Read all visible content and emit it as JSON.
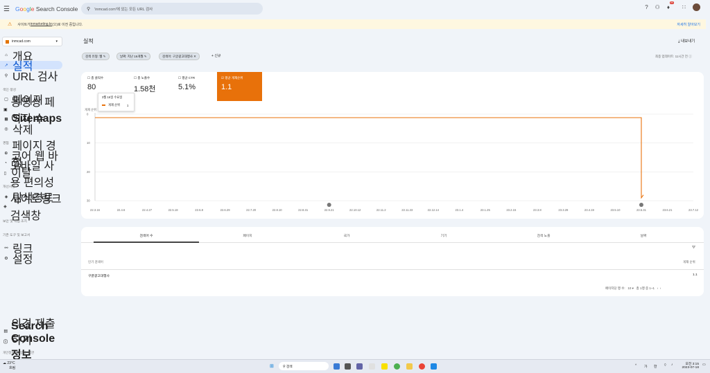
{
  "app": {
    "title": "Google Search Console"
  },
  "search": {
    "placeholder": "'inmcad.com'에 있는 모든 URL 검사"
  },
  "header_icons": [
    "help-icon",
    "people-icon",
    "bell-icon",
    "apps-icon"
  ],
  "notification_count": "99",
  "banner": {
    "prefix": "사이트가 ",
    "site": "inmarketing.kr",
    "suffix": "(으)로 이전 중입니다.",
    "more": "자세히 알아보기"
  },
  "property": "inmcad.com",
  "nav": {
    "overview": "개요",
    "performance": "실적",
    "url_inspection": "URL 검사",
    "section_index": "색인 생성",
    "pages": "페이지",
    "video_pages": "동영상 페이지 수",
    "sitemaps": "Sitemaps",
    "removals": "삭제",
    "section_experience": "경험",
    "page_experience": "페이지 경험",
    "core_web_vitals": "코어 웹 바이탈",
    "mobile_usability": "모바일 사용 편의성",
    "section_enhancements": "개선사항",
    "breadcrumbs": "탐색경로",
    "sitelinks_searchbox": "사이트링크 검색창",
    "section_security": "보안 및 직접 조치",
    "section_legacy": "기존 도구 및 보고서",
    "links": "링크",
    "settings": "설정",
    "feedback": "의견 제출하기",
    "about": "Search Console 정보",
    "privacy": "개인정보처리방침",
    "terms": "약관"
  },
  "page": {
    "title": "실적",
    "export": "내보내기",
    "updated": "최종 업데이트: 11시간 전"
  },
  "filters": [
    {
      "label": "검색 유형: 웹"
    },
    {
      "label": "날짜: 지난 16개월"
    },
    {
      "label": "검색어: 구글광고대행사"
    }
  ],
  "new_filter": "신규",
  "metrics": [
    {
      "label": "총 클릭수",
      "value": "80"
    },
    {
      "label": "총 노출수",
      "value": "1.58천"
    },
    {
      "label": "평균 CTR",
      "value": "5.1%"
    },
    {
      "label": "평균 게재순위",
      "value": "1.1"
    }
  ],
  "tooltip": {
    "date": "3월 16일 수요일",
    "series": "게재 순위",
    "value": "1"
  },
  "chart_data": {
    "type": "line",
    "ylabel": "게재 순위",
    "y_ticks": [
      "0",
      "10",
      "20",
      "30"
    ],
    "ylim": [
      0,
      30
    ],
    "y_inverted": true,
    "x_ticks": [
      "22.3.16",
      "22.4.6",
      "22.4.27",
      "22.5.18",
      "22.6.8",
      "22.6.29",
      "22.7.20",
      "22.8.10",
      "22.8.31",
      "22.9.21",
      "22.10.12",
      "22.11.2",
      "22.11.23",
      "22.12.14",
      "23.1.4",
      "23.1.25",
      "23.2.15",
      "23.3.8",
      "23.3.29",
      "23.4.19",
      "23.5.10",
      "23.5.31",
      "23.6.21",
      "23.7.12"
    ],
    "series": [
      {
        "name": "게재 순위",
        "color": "#e8710a",
        "points": [
          [
            "22.3.16",
            1.2
          ],
          [
            "22.4.6",
            1.2
          ],
          [
            "22.4.27",
            1.2
          ],
          [
            "22.5.18",
            1.2
          ],
          [
            "22.6.8",
            1.2
          ],
          [
            "22.6.29",
            1.2
          ],
          [
            "22.7.20",
            1.2
          ],
          [
            "22.8.10",
            1.2
          ],
          [
            "22.8.31",
            1.2
          ],
          [
            "22.9.21",
            1.2
          ],
          [
            "22.10.12",
            1.2
          ],
          [
            "22.11.2",
            1.2
          ],
          [
            "22.11.23",
            1.2
          ],
          [
            "22.12.14",
            1.2
          ],
          [
            "23.1.4",
            1.2
          ],
          [
            "23.1.25",
            1.2
          ],
          [
            "23.2.15",
            1.2
          ],
          [
            "23.3.8",
            1.2
          ],
          [
            "23.3.29",
            1.2
          ],
          [
            "23.4.19",
            1.2
          ],
          [
            "23.5.10",
            1.2
          ],
          [
            "23.5.31",
            1.2
          ],
          [
            "23.5.31",
            29
          ],
          [
            "23.6.1",
            28
          ]
        ]
      }
    ]
  },
  "tabs": [
    "검색어 수",
    "페이지",
    "국가",
    "기기",
    "검색 노출",
    "날짜"
  ],
  "table": {
    "col_query": "인기 검색어",
    "col_position": "게재 순위",
    "rows": [
      {
        "query": "구글광고대행사",
        "position": "1.1"
      }
    ],
    "rows_per_page_label": "페이지당 행 수:",
    "rows_per_page": "10",
    "range": "총 1행 중 1~1"
  },
  "taskbar": {
    "temp": "23°C",
    "weather": "흐림",
    "search": "검색",
    "lang1": "가",
    "lang2": "한",
    "time": "오전 3:15",
    "date": "2023-07-18"
  }
}
